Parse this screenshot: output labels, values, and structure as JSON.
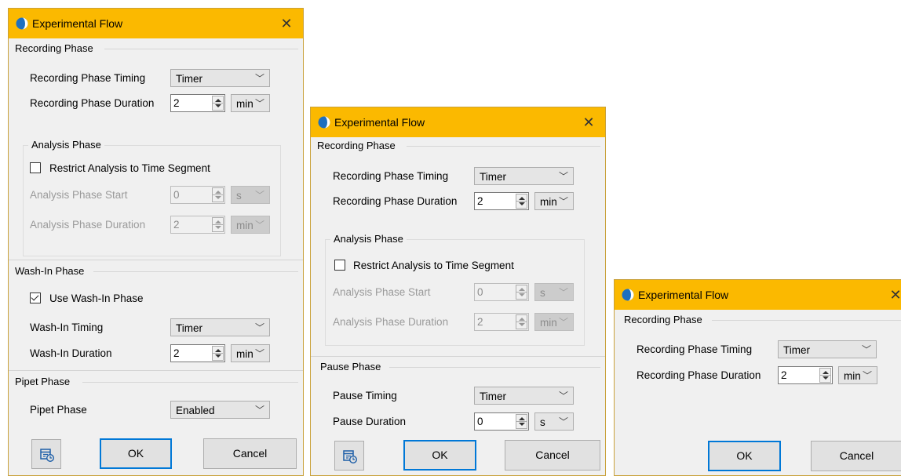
{
  "dialog1": {
    "title": "Experimental Flow",
    "recording_phase": {
      "header": "Recording Phase",
      "timing_label": "Recording Phase Timing",
      "timing_value": "Timer",
      "duration_label": "Recording Phase Duration",
      "duration_value": "2",
      "duration_unit": "min"
    },
    "analysis_phase": {
      "header": "Analysis Phase",
      "restrict_label": "Restrict Analysis to Time Segment",
      "restrict_checked": false,
      "start_label": "Analysis Phase Start",
      "start_value": "0",
      "start_unit": "s",
      "duration_label": "Analysis Phase Duration",
      "duration_value": "2",
      "duration_unit": "min"
    },
    "washin_phase": {
      "header": "Wash-In Phase",
      "use_label": "Use Wash-In Phase",
      "use_checked": true,
      "timing_label": "Wash-In Timing",
      "timing_value": "Timer",
      "duration_label": "Wash-In Duration",
      "duration_value": "2",
      "duration_unit": "min"
    },
    "pipet_phase": {
      "header": "Pipet Phase",
      "label": "Pipet Phase",
      "value": "Enabled"
    },
    "buttons": {
      "ok": "OK",
      "cancel": "Cancel"
    }
  },
  "dialog2": {
    "title": "Experimental Flow",
    "recording_phase": {
      "header": "Recording Phase",
      "timing_label": "Recording Phase Timing",
      "timing_value": "Timer",
      "duration_label": "Recording Phase Duration",
      "duration_value": "2",
      "duration_unit": "min"
    },
    "analysis_phase": {
      "header": "Analysis Phase",
      "restrict_label": "Restrict Analysis to Time Segment",
      "restrict_checked": false,
      "start_label": "Analysis Phase Start",
      "start_value": "0",
      "start_unit": "s",
      "duration_label": "Analysis Phase Duration",
      "duration_value": "2",
      "duration_unit": "min"
    },
    "pause_phase": {
      "header": "Pause Phase",
      "timing_label": "Pause Timing",
      "timing_value": "Timer",
      "duration_label": "Pause Duration",
      "duration_value": "0",
      "duration_unit": "s"
    },
    "buttons": {
      "ok": "OK",
      "cancel": "Cancel"
    }
  },
  "dialog3": {
    "title": "Experimental Flow",
    "recording_phase": {
      "header": "Recording Phase",
      "timing_label": "Recording Phase Timing",
      "timing_value": "Timer",
      "duration_label": "Recording Phase Duration",
      "duration_value": "2",
      "duration_unit": "min"
    },
    "buttons": {
      "ok": "OK",
      "cancel": "Cancel"
    }
  },
  "colors": {
    "titlebar": "#fbb900",
    "dialog_bg": "#f0f0f0",
    "primary_border": "#0078d7",
    "app_icon": "#1e6fbf"
  },
  "icons": {
    "app": "half-moon-clock-icon",
    "close": "close-icon",
    "dropdown": "chevron-down-icon",
    "schedule": "calendar-clock-icon"
  }
}
